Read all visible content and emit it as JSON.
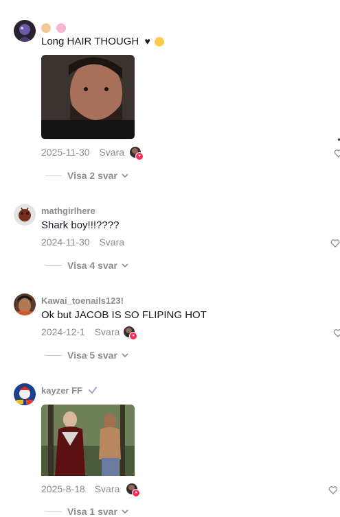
{
  "comments": [
    {
      "username": "",
      "badges": [
        "baby-face-icon",
        "kiss-lips-icon"
      ],
      "text": "Long HAIR THOUGH",
      "text_emojis": [
        "black-heart-icon",
        "tongue-face-icon"
      ],
      "has_media": true,
      "date": "2025-11-30",
      "reply_label": "Svara",
      "creator_liked": true,
      "view_replies": "Visa 2 svar"
    },
    {
      "username": "mathgirlhere",
      "text": "Shark boy!!!????",
      "has_media": false,
      "date": "2024-11-30",
      "reply_label": "Svara",
      "creator_liked": false,
      "view_replies": "Visa 4 svar"
    },
    {
      "username": "Kawai_toenails123!",
      "text": "Ok but JACOB IS SO FLIPING HOT",
      "has_media": false,
      "date": "2024-12-1",
      "reply_label": "Svara",
      "creator_liked": true,
      "view_replies": "Visa 5 svar"
    },
    {
      "username": "kayzer FF",
      "verified_icon": "checkmark-icon",
      "text": "",
      "has_media": true,
      "date": "2025-8-18",
      "reply_label": "Svara",
      "creator_liked": true,
      "view_replies": "Visa 1 svar"
    }
  ],
  "colors": {
    "muted_text": "#8a8b91",
    "primary_text": "#161823",
    "badge_red": "#fe2c55",
    "verified": "#a9a3d6"
  }
}
